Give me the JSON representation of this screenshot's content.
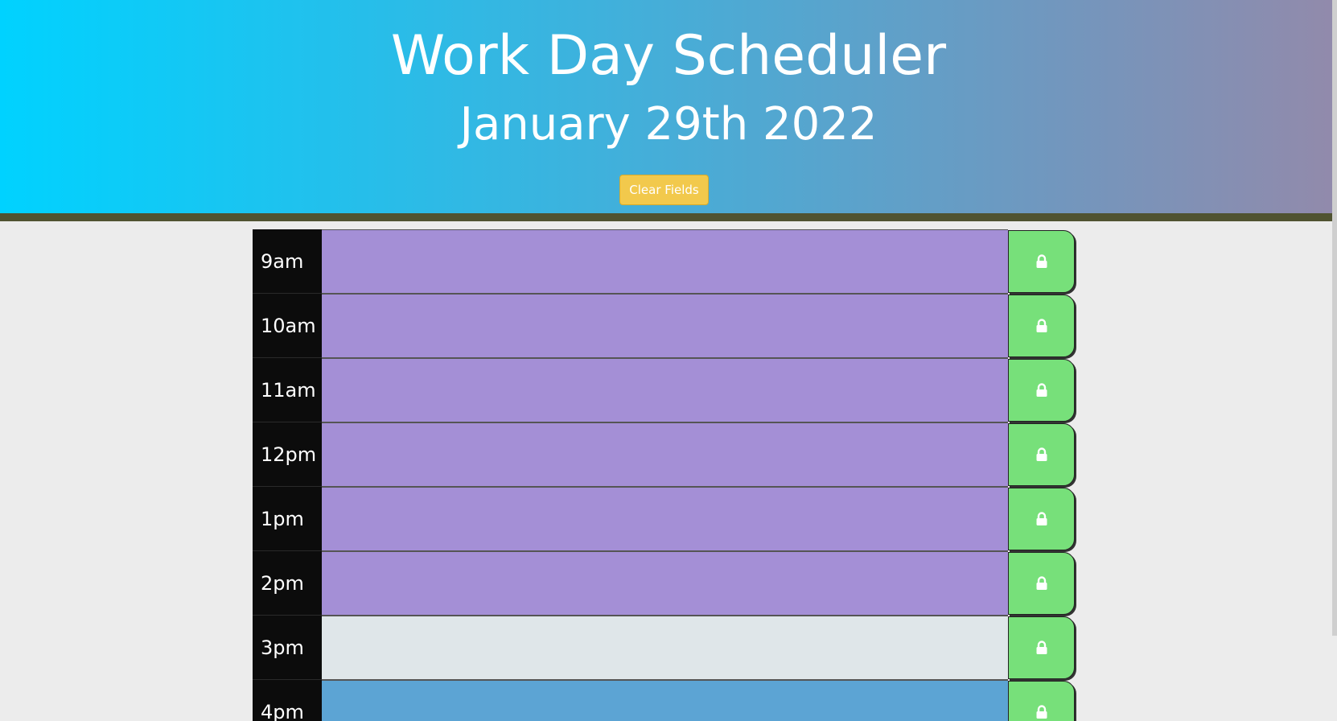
{
  "header": {
    "title": "Work Day Scheduler",
    "date": "January 29th 2022",
    "clear_label": "Clear Fields"
  },
  "colors": {
    "past": "#a48fd6",
    "present": "#dfe6e9",
    "future": "#5ca4d4",
    "save": "#77e07a",
    "clear": "#f2c94c"
  },
  "rows": [
    {
      "hour": "9am",
      "state": "past",
      "text": "",
      "icon": "lock-icon"
    },
    {
      "hour": "10am",
      "state": "past",
      "text": "",
      "icon": "lock-icon"
    },
    {
      "hour": "11am",
      "state": "past",
      "text": "",
      "icon": "lock-icon"
    },
    {
      "hour": "12pm",
      "state": "past",
      "text": "",
      "icon": "lock-icon"
    },
    {
      "hour": "1pm",
      "state": "past",
      "text": "",
      "icon": "lock-icon"
    },
    {
      "hour": "2pm",
      "state": "past",
      "text": "",
      "icon": "lock-icon"
    },
    {
      "hour": "3pm",
      "state": "present",
      "text": "",
      "icon": "lock-icon"
    },
    {
      "hour": "4pm",
      "state": "future",
      "text": "",
      "icon": "lock-icon"
    }
  ]
}
